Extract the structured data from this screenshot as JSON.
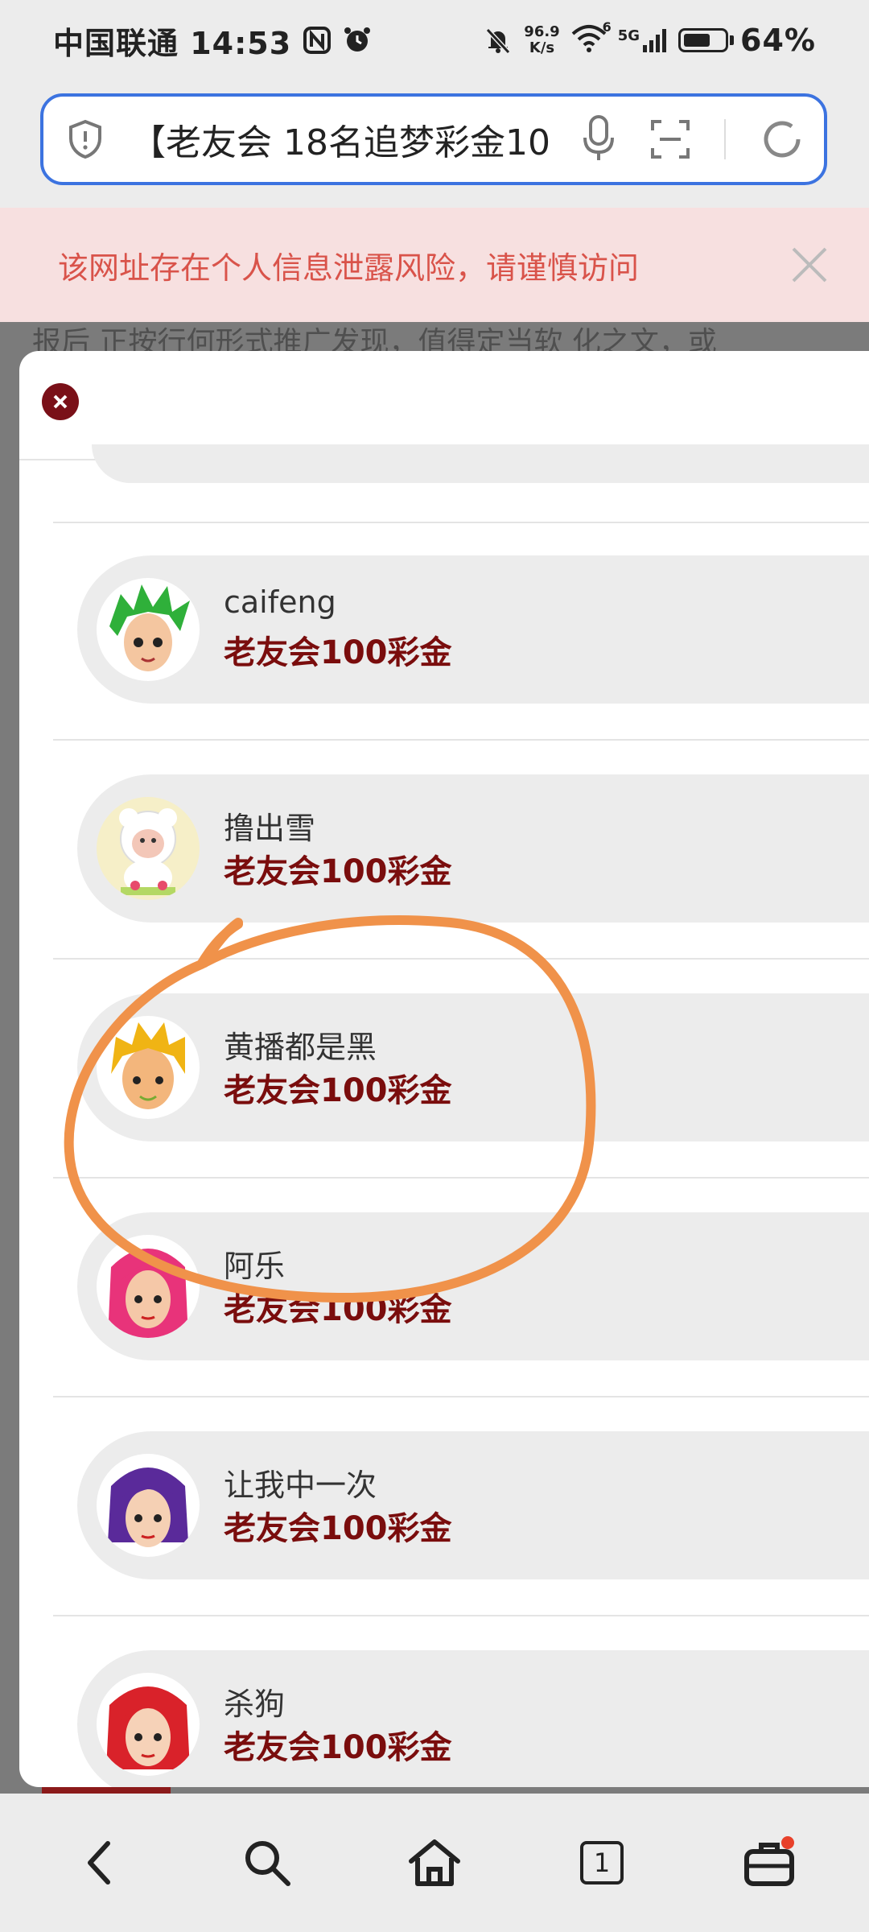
{
  "status_bar": {
    "carrier_time": "中国联通 14:53",
    "speed_value": "96.9",
    "speed_unit": "K/s",
    "network": "5G",
    "wifi_badge": "6",
    "battery": "64%",
    "battery_level": 0.64
  },
  "address_bar": {
    "url_text": "【老友会 18名追梦彩金10"
  },
  "warning": {
    "text": "该网址存在个人信息泄露风险，请谨慎访问"
  },
  "page_under": {
    "hint": "报后 正按行何形式推广发现，值得定当软 化之文，或"
  },
  "modal": {
    "items": [
      {
        "name": "caifeng",
        "prize": "老友会100彩金",
        "avatar": "green-hair-avatar"
      },
      {
        "name": "撸出雪",
        "prize": "老友会100彩金",
        "avatar": "sheep-avatar"
      },
      {
        "name": "黄播都是黑",
        "prize": "老友会100彩金",
        "avatar": "blonde-hair-avatar"
      },
      {
        "name": "阿乐",
        "prize": "老友会100彩金",
        "avatar": "pink-hair-avatar"
      },
      {
        "name": "让我中一次",
        "prize": "老友会100彩金",
        "avatar": "purple-hair-avatar"
      },
      {
        "name": "杀狗",
        "prize": "老友会100彩金",
        "avatar": "red-hair-avatar"
      }
    ]
  },
  "bottom_nav": {
    "tab_count": "1"
  },
  "colors": {
    "accent_blue": "#3c73e0",
    "warning_bg": "#f7e0e0",
    "warning_text": "#d9534a",
    "prize_text": "#7a0d0d",
    "annotation_orange": "#f0924a"
  }
}
